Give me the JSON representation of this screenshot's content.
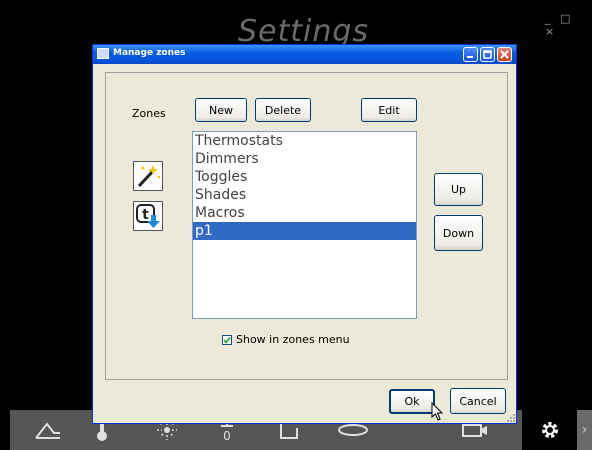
{
  "screen": {
    "title": "Settings",
    "window_controls": {
      "minimize": "_",
      "maximize": "□",
      "close": "×"
    }
  },
  "dialog": {
    "title": "Manage zones",
    "zones_label": "Zones",
    "buttons": {
      "new": "New",
      "delete": "Delete",
      "edit": "Edit",
      "up": "Up",
      "down": "Down",
      "ok": "Ok",
      "cancel": "Cancel"
    },
    "zones": [
      {
        "name": "Thermostats",
        "selected": false
      },
      {
        "name": "Dimmers",
        "selected": false
      },
      {
        "name": "Toggles",
        "selected": false
      },
      {
        "name": "Shades",
        "selected": false
      },
      {
        "name": "Macros",
        "selected": false
      },
      {
        "name": "p1",
        "selected": true
      }
    ],
    "show_in_menu": {
      "label": "Show in zones menu",
      "checked": true
    },
    "icons": [
      "wizard-wand-icon",
      "import-download-icon"
    ]
  },
  "bottom_nav": {
    "items": [
      "home-icon",
      "thermostat-icon",
      "dimmer-icon",
      "toggle-icon",
      "shades-icon",
      "macro-icon",
      "camera-icon",
      "settings-icon",
      "next-icon"
    ],
    "active": "settings-icon",
    "next_label": "›"
  },
  "colors": {
    "titlebar": "#0554d8",
    "selection": "#316ac5",
    "dialog_bg": "#ece9d8"
  }
}
